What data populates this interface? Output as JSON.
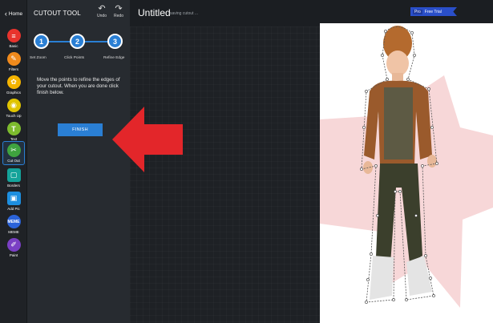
{
  "rail": {
    "home_label": "Home",
    "tools": [
      {
        "label": "Basic",
        "color": "#e8332d",
        "glyph": "≡"
      },
      {
        "label": "Filters",
        "color": "#f08a1c",
        "glyph": "✎"
      },
      {
        "label": "Graphics",
        "color": "#f5b400",
        "glyph": "✿"
      },
      {
        "label": "Touch Up",
        "color": "#e0c400",
        "glyph": "◉"
      },
      {
        "label": "Text",
        "color": "#7dbb2e",
        "glyph": "T"
      },
      {
        "label": "Cut Out",
        "color": "#3fa33f",
        "glyph": "✂"
      },
      {
        "label": "Borders",
        "color": "#14a39a",
        "glyph": "▢"
      },
      {
        "label": "Add Pic",
        "color": "#1d8fe0",
        "glyph": "▣"
      },
      {
        "label": "MEME",
        "color": "#2b63d9",
        "glyph": "M"
      },
      {
        "label": "Paint",
        "color": "#7a3fc4",
        "glyph": "✐"
      }
    ]
  },
  "panel": {
    "title": "CUTOUT TOOL",
    "undo_label": "Undo",
    "redo_label": "Redo",
    "steps": [
      {
        "number": "1",
        "label": "Set Zoom"
      },
      {
        "number": "2",
        "label": "Click Points"
      },
      {
        "number": "3",
        "label": "Refine Edge"
      }
    ],
    "instructions": "Move the points to refine the edges of your cutout. When you are done click finish below.",
    "finish_label": "FINISH"
  },
  "header": {
    "title": "Untitled",
    "status": "saving cutout ...",
    "pro_label": "Pro",
    "trial_label": "Free Trial"
  },
  "colors": {
    "accent": "#2a7fd4",
    "arrow": "#e3262a"
  }
}
